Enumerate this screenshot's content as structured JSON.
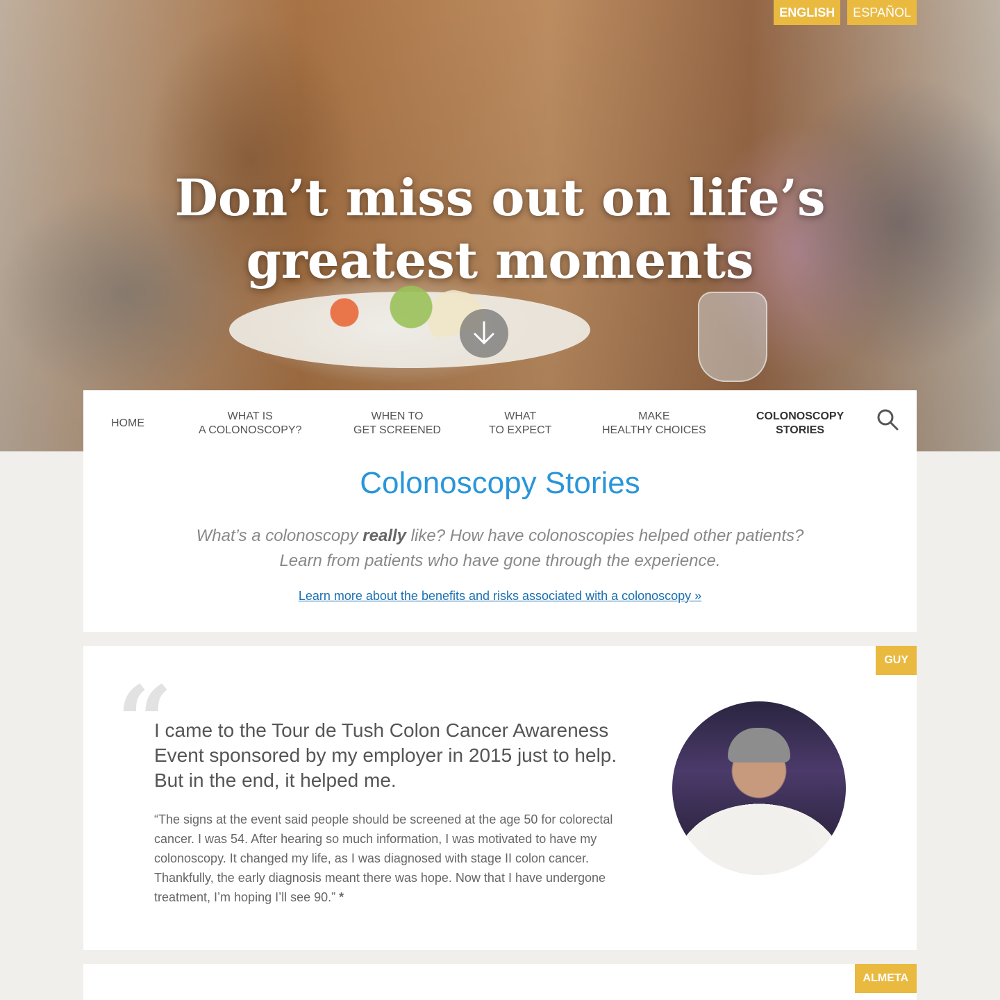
{
  "language": {
    "english": "ENGLISH",
    "espanol": "ESPAÑOL"
  },
  "hero": {
    "title_line1": "Don’t miss out on life’s",
    "title_line2": "greatest moments",
    "scroll_icon": "arrow-down-icon"
  },
  "nav": {
    "items": [
      {
        "line1": "HOME",
        "line2": ""
      },
      {
        "line1": "WHAT IS",
        "line2": "A COLONOSCOPY?"
      },
      {
        "line1": "WHEN TO",
        "line2": "GET SCREENED"
      },
      {
        "line1": "WHAT",
        "line2": "TO EXPECT"
      },
      {
        "line1": "MAKE",
        "line2": "HEALTHY CHOICES"
      },
      {
        "line1": "COLONOSCOPY",
        "line2": "STORIES"
      }
    ],
    "search_icon": "search-icon"
  },
  "intro": {
    "title": "Colonoscopy Stories",
    "line1_a": "What’s a colonoscopy ",
    "line1_b": "really",
    "line1_c": " like? How have colonoscopies helped other patients?",
    "line2": "Learn from patients who have gone through the experience.",
    "link": "Learn more about the benefits and risks associated with a colonoscopy »"
  },
  "story": {
    "tag": "GUY",
    "quote_mark": "“",
    "headline": "I came to the Tour de Tush Colon Cancer Awareness Event sponsored by my employer in 2015 just to help. But in the end, it helped me.",
    "body": "“The signs at the event said people should be screened at the age 50 for colorectal cancer. I was 54. After hearing so much information, I was motivated to have my colonoscopy. It changed my life, as I was diagnosed with stage II colon cancer. Thankfully, the early diagnosis meant there was hope. Now that I have undergone treatment, I’m hoping I’ll see 90.”",
    "asterisk": "*"
  },
  "story2": {
    "tag": "ALMETA"
  },
  "colors": {
    "accent_yellow": "#e9b940",
    "title_blue": "#2a96d9",
    "link_blue": "#1a6fb0"
  }
}
